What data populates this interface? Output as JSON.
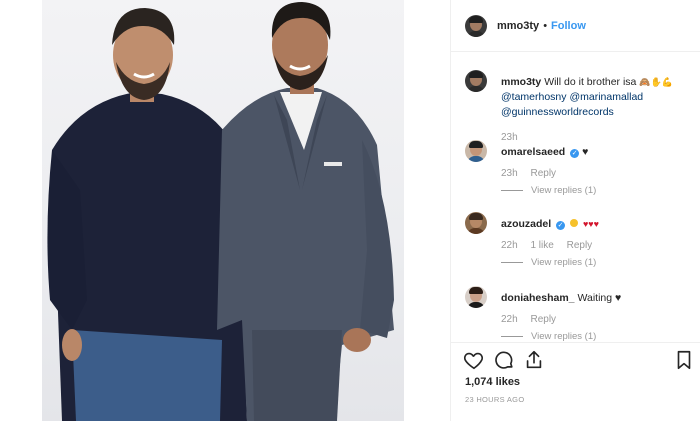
{
  "post": {
    "username": "mmo3ty",
    "separator": "•",
    "follow_label": "Follow"
  },
  "caption": {
    "username": "mmo3ty",
    "text": "Will do it brother isa",
    "emojis": "🙈✋💪",
    "mentions": [
      "@tamerhosny",
      "@marinamallad",
      "@guinnessworldrecords"
    ],
    "time": "23h"
  },
  "comments": [
    {
      "username": "omarelsaeed",
      "verified": true,
      "text": "♥",
      "time": "23h",
      "likes": "",
      "reply_label": "Reply",
      "view_replies": "View replies (1)"
    },
    {
      "username": "azouzadel",
      "verified": true,
      "text": "♥♥♥",
      "time": "22h",
      "likes": "1 like",
      "reply_label": "Reply",
      "view_replies": "View replies (1)"
    },
    {
      "username": "doniahesham_",
      "verified": false,
      "text": "Waiting",
      "text_suffix": "♥",
      "time": "22h",
      "likes": "",
      "reply_label": "Reply",
      "view_replies": "View replies (1)"
    }
  ],
  "footer": {
    "likes_count": "1,074 likes",
    "timestamp": "23 HOURS AGO"
  },
  "icons": [
    "heart-icon",
    "comment-icon",
    "share-icon",
    "bookmark-icon",
    "verified-badge-icon"
  ],
  "colors": {
    "link_blue": "#3897f0",
    "mention_blue": "#003569",
    "heart_red": "#d3152d",
    "muted_gray": "#999999"
  }
}
